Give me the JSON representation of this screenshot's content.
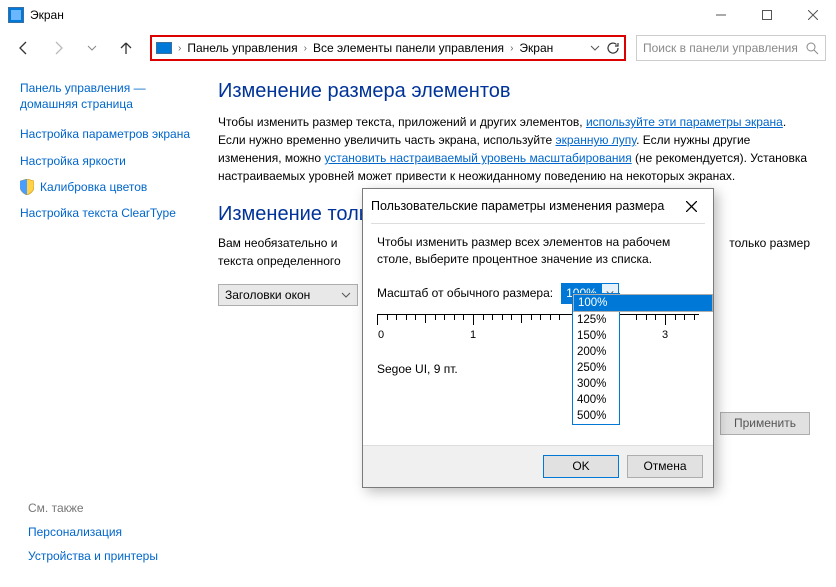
{
  "window": {
    "title": "Экран"
  },
  "breadcrumbs": {
    "item0": "Панель управления",
    "item1": "Все элементы панели управления",
    "item2": "Экран"
  },
  "search": {
    "placeholder": "Поиск в панели управления"
  },
  "sidebar": {
    "home": "Панель управления — домашняя страница",
    "links": {
      "l0": "Настройка параметров экрана",
      "l1": "Настройка яркости",
      "l2": "Калибровка цветов",
      "l3": "Настройка текста ClearType"
    }
  },
  "main": {
    "h1": "Изменение размера элементов",
    "p1a": "Чтобы изменить размер текста, приложений и других элементов, ",
    "p1link1": "используйте эти параметры экрана",
    "p1b": ". Если нужно временно увеличить часть экрана, используйте ",
    "p1link2": "экранную лупу",
    "p1c": ". Если нужны другие изменения, можно ",
    "p1link3": "установить настраиваемый уровень масштабирования",
    "p1d": " (не рекомендуется). Установка настраиваемых уровней может привести к неожиданному поведению на некоторых экранах.",
    "h2": "Изменение толь",
    "p2a": "Вам необязательно и",
    "p2b": "только размер",
    "p2c": "текста определенного",
    "dropdown_label": "Заголовки окон",
    "apply": "Применить"
  },
  "seealso": {
    "header": "См. также",
    "l0": "Персонализация",
    "l1": "Устройства и принтеры"
  },
  "dialog": {
    "title": "Пользовательские параметры изменения размера",
    "body": "Чтобы изменить размер всех элементов на рабочем столе, выберите процентное значение из списка.",
    "scale_label": "Масштаб от обычного размера:",
    "selected": "100%",
    "options": {
      "o0": "100%",
      "o1": "125%",
      "o2": "150%",
      "o3": "200%",
      "o4": "250%",
      "o5": "300%",
      "o6": "400%",
      "o7": "500%"
    },
    "ruler": {
      "t0": "0",
      "t1": "1",
      "t3": "3"
    },
    "font_sample": "Segoe UI, 9 пт.",
    "ok": "OK",
    "cancel": "Отмена"
  }
}
